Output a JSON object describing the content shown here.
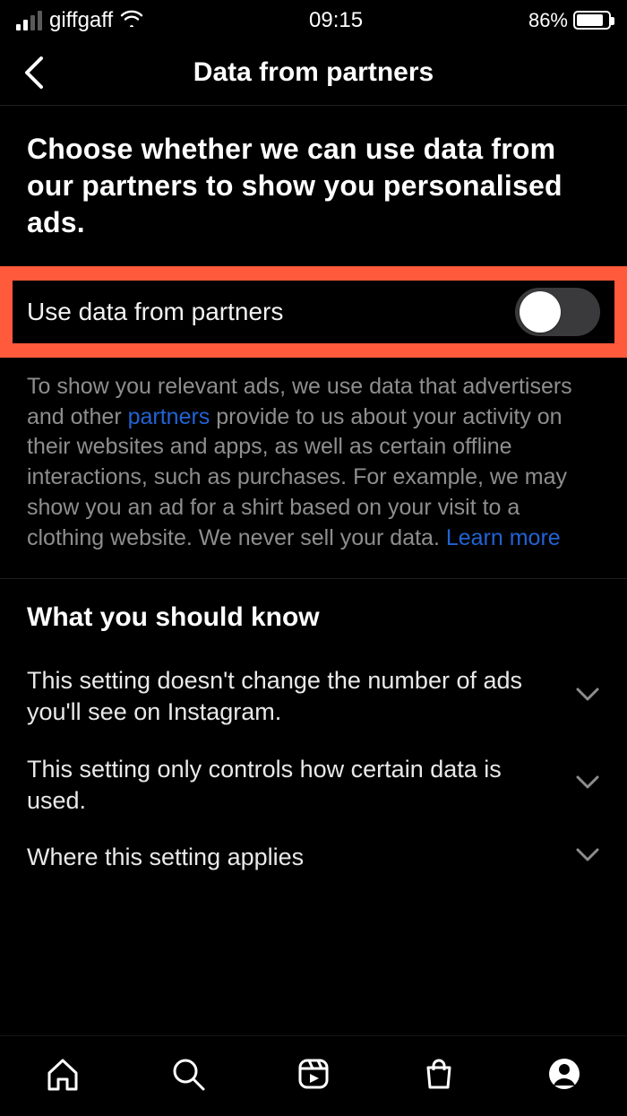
{
  "status": {
    "carrier": "giffgaff",
    "time": "09:15",
    "battery_pct": "86%"
  },
  "nav": {
    "title": "Data from partners"
  },
  "headline": "Choose whether we can use data from our partners to show you personalised ads.",
  "toggle": {
    "label": "Use data from partners",
    "on": false
  },
  "desc": {
    "pre": "To show you relevant ads, we use data that advertisers and other ",
    "link1": "partners",
    "mid": " provide to us about your activity on their websites and apps, as well as certain offline interactions, such as purchases. For example, we may show you an ad for a shirt based on your visit to a clothing website. We never sell your data. ",
    "link2": "Learn more"
  },
  "wys": {
    "title": "What you should know",
    "rows": [
      "This setting doesn't change the number of ads you'll see on Instagram.",
      "This setting only controls how certain data is used.",
      "Where this setting applies"
    ]
  },
  "tabs": [
    "home",
    "search",
    "reels",
    "shop",
    "profile"
  ]
}
